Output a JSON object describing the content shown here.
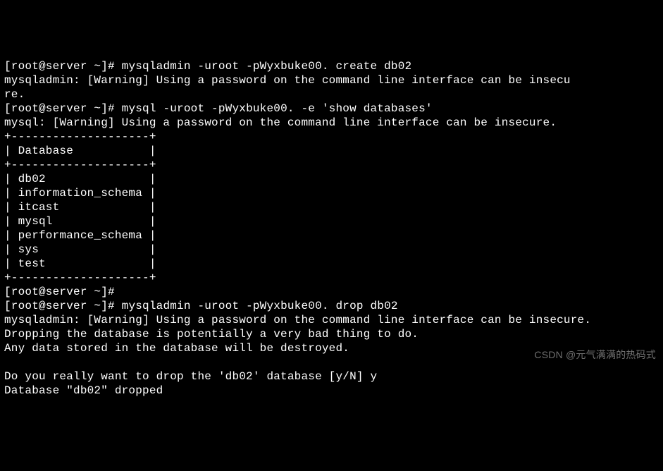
{
  "prompt": "[root@server ~]#",
  "cmd1": "mysqladmin -uroot -pWyxbuke00. create db02",
  "warn1a": "mysqladmin: [Warning] Using a password on the command line interface can be insecu",
  "warn1b": "re.",
  "cmd2": "mysql -uroot -pWyxbuke00. -e 'show databases'",
  "warn2": "mysql: [Warning] Using a password on the command line interface can be insecure.",
  "table": {
    "border": "+--------------------+",
    "header": "| Database           |",
    "rows": [
      "| db02               |",
      "| information_schema |",
      "| itcast             |",
      "| mysql              |",
      "| performance_schema |",
      "| sys                |",
      "| test               |"
    ]
  },
  "cmd3": "mysqladmin -uroot -pWyxbuke00. drop db02",
  "warn3": "mysqladmin: [Warning] Using a password on the command line interface can be insecure.",
  "drop_msg1": "Dropping the database is potentially a very bad thing to do.",
  "drop_msg2": "Any data stored in the database will be destroyed.",
  "confirm_q": "Do you really want to drop the 'db02' database [y/N]",
  "confirm_a": "y",
  "dropped": "Database \"db02\" dropped",
  "watermark": "CSDN @元气满满的热码式"
}
